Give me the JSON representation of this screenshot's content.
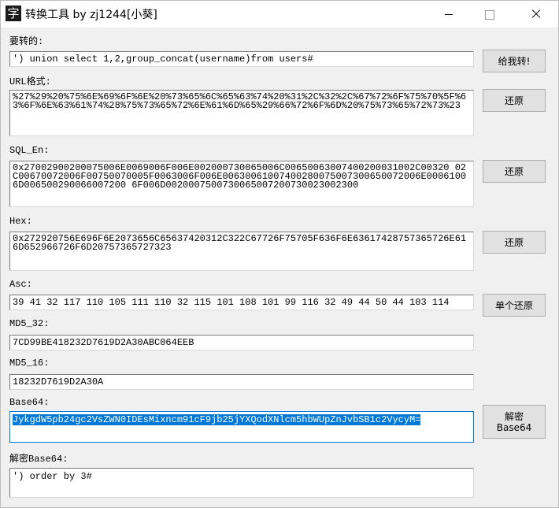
{
  "window": {
    "title": "转换工具 by zj1244[小葵]",
    "icon": "app-glyph-icon"
  },
  "fields": {
    "input": {
      "label": "要转的:",
      "value": "') union select 1,2,group_concat(username)from users#"
    },
    "url": {
      "label": "URL格式:",
      "value": "%27%29%20%75%6E%69%6F%6E%20%73%65%6C%65%63%74%20%31%2C%32%2C%67%72%6F%75%70%5F%63%6F%6E%63%61%74%28%75%73%65%72%6E%61%6D%65%29%66%72%6F%6D%20%75%73%65%72%73%23"
    },
    "sql_en": {
      "label": "SQL_En:",
      "value": "0x27002900200075006E0069006F006E002000730065006C00650063007400200031002C00320 02C00670072006F00750070005F0063006F006E00630061007400280075007300650072006E00061006D006500290066007200 6F006D0020007500730065007200730023002300"
    },
    "hex": {
      "label": "Hex:",
      "value": "0x272920756E696F6E2073656C65637420312C322C67726F75705F636F6E63617428757365726E616D652966726F6D20757365727323"
    },
    "asc": {
      "label": "Asc:",
      "value": "39 41 32 117 110 105 111 110 32 115 101 108 101 99 116 32 49 44 50 44 103 114"
    },
    "md5_32": {
      "label": "MD5_32:",
      "value": "7CD99BE418232D7619D2A30ABC064EEB"
    },
    "md5_16": {
      "label": "MD5_16:",
      "value": "18232D7619D2A30A"
    },
    "base64": {
      "label": "Base64:",
      "value": "JykgdW5pb24gc2VsZWN0IDEsMixncm91cF9jb25jYXQodXNlcm5hbWUpZnJvbSB1c2VycyM="
    },
    "decoded_base64": {
      "label": "解密Base64:",
      "value": "') order by 3#"
    }
  },
  "buttons": {
    "convert": "给我转!",
    "restore_url": "还原",
    "restore_sql": "还原",
    "restore_hex": "还原",
    "restore_asc": "单个还原",
    "decrypt_base64": "解密\nBase64"
  }
}
